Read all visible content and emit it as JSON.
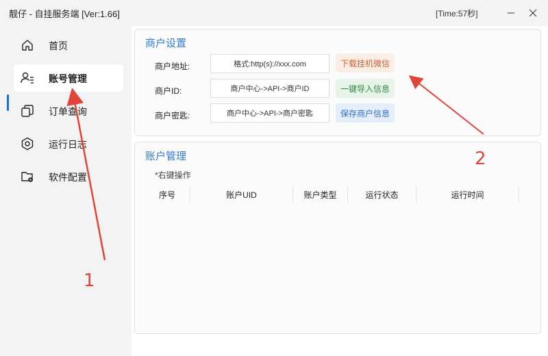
{
  "window": {
    "title": "靓仔 - 自挂服务端  [Ver:1.66]",
    "time": "[Time:57秒]"
  },
  "sidebar": {
    "items": [
      {
        "label": "首页",
        "icon": "home-icon"
      },
      {
        "label": "账号管理",
        "icon": "user-list-icon",
        "active": true
      },
      {
        "label": "订单查询",
        "icon": "copy-icon"
      },
      {
        "label": "运行日志",
        "icon": "hexagon-icon"
      },
      {
        "label": "软件配置",
        "icon": "folder-gear-icon"
      }
    ]
  },
  "merchant": {
    "title": "商户设置",
    "fields": [
      {
        "label": "商户地址:",
        "value": "格式:http(s)://xxx.com"
      },
      {
        "label": "商户ID:",
        "value": "商户中心->API->商户ID"
      },
      {
        "label": "商户密匙:",
        "value": "商户中心->API->商户密匙"
      }
    ],
    "buttons": {
      "download": "下载挂机微信",
      "import": "一键导入信息",
      "save": "保存商户信息"
    }
  },
  "accounts": {
    "title": "账户管理",
    "hint": "*右键操作",
    "columns": [
      "序号",
      "账户UID",
      "账户类型",
      "运行状态",
      "运行时间"
    ]
  },
  "annotations": {
    "label_1": "1",
    "label_2": "2",
    "color": "#e0453a"
  },
  "colors": {
    "accent": "#2f7bd5",
    "indicator": "#1a6fd6"
  }
}
